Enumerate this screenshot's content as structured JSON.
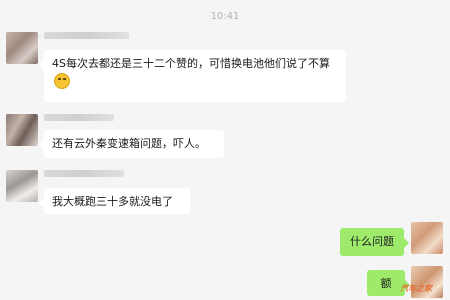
{
  "timestamp": "10:41",
  "messages": [
    {
      "direction": "in",
      "text": "4S每次去都还是三十二个赞的，可惜换电池他们说了不算"
    },
    {
      "direction": "in",
      "text": "还有云外秦变速箱问题，吓人。"
    },
    {
      "direction": "in",
      "text": "我大概跑三十多就没电了"
    },
    {
      "direction": "out",
      "text": "什么问题"
    },
    {
      "direction": "out",
      "text": "额"
    }
  ],
  "emoji": "grimace-emoji",
  "colors": {
    "background": "#f5f5f5",
    "incoming_bubble": "#ffffff",
    "outgoing_bubble": "#9eea6a",
    "timestamp": "#b2b2b2"
  },
  "watermark": "汽车之家"
}
